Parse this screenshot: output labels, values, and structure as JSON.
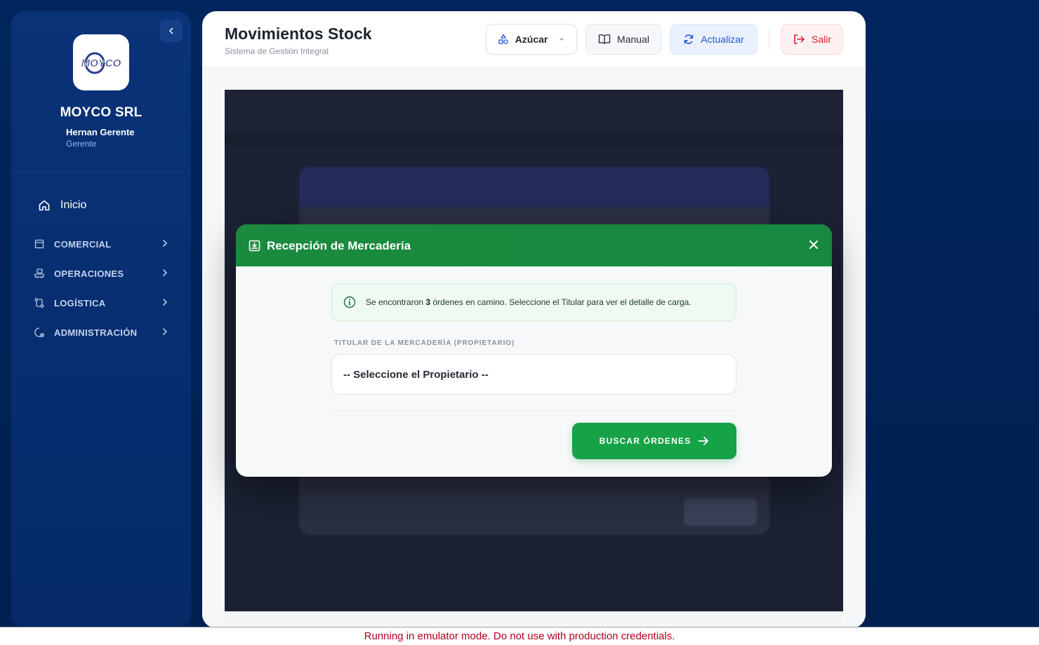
{
  "sidebar": {
    "company": "MOYCO SRL",
    "logo_text": "MOYCO",
    "user": {
      "name": "Hernan Gerente",
      "role": "Gerente"
    },
    "home_label": "Inicio",
    "items": [
      {
        "label": "COMERCIAL",
        "icon": "store-icon"
      },
      {
        "label": "OPERACIONES",
        "icon": "operations-icon"
      },
      {
        "label": "LOGÍSTICA",
        "icon": "route-icon"
      },
      {
        "label": "ADMINISTRACIÓN",
        "icon": "admin-gear-icon"
      }
    ]
  },
  "header": {
    "title": "Movimientos Stock",
    "subtitle": "Sistema de Gestión Integral",
    "product_label": "Azúcar",
    "manual_label": "Manual",
    "refresh_label": "Actualizar",
    "exit_label": "Salir"
  },
  "modal": {
    "title": "Recepción de Mercadería",
    "info_prefix": "Se encontraron ",
    "info_count": "3",
    "info_suffix": " órdenes en camino. Seleccione el Titular para ver el detalle de carga.",
    "field_label": "TITULAR DE LA MERCADERÍA (PROPIETARIO)",
    "select_value": "-- Seleccione el Propietario --",
    "search_button": "BUSCAR ÓRDENES"
  },
  "footer_notice": "Running in emulator mode. Do not use with production credentials.",
  "colors": {
    "sidebar": "#0a3378",
    "modal_header": "#1a8a3e",
    "primary_green": "#16a247",
    "danger": "#d3242b",
    "accent_blue": "#2458d6"
  }
}
